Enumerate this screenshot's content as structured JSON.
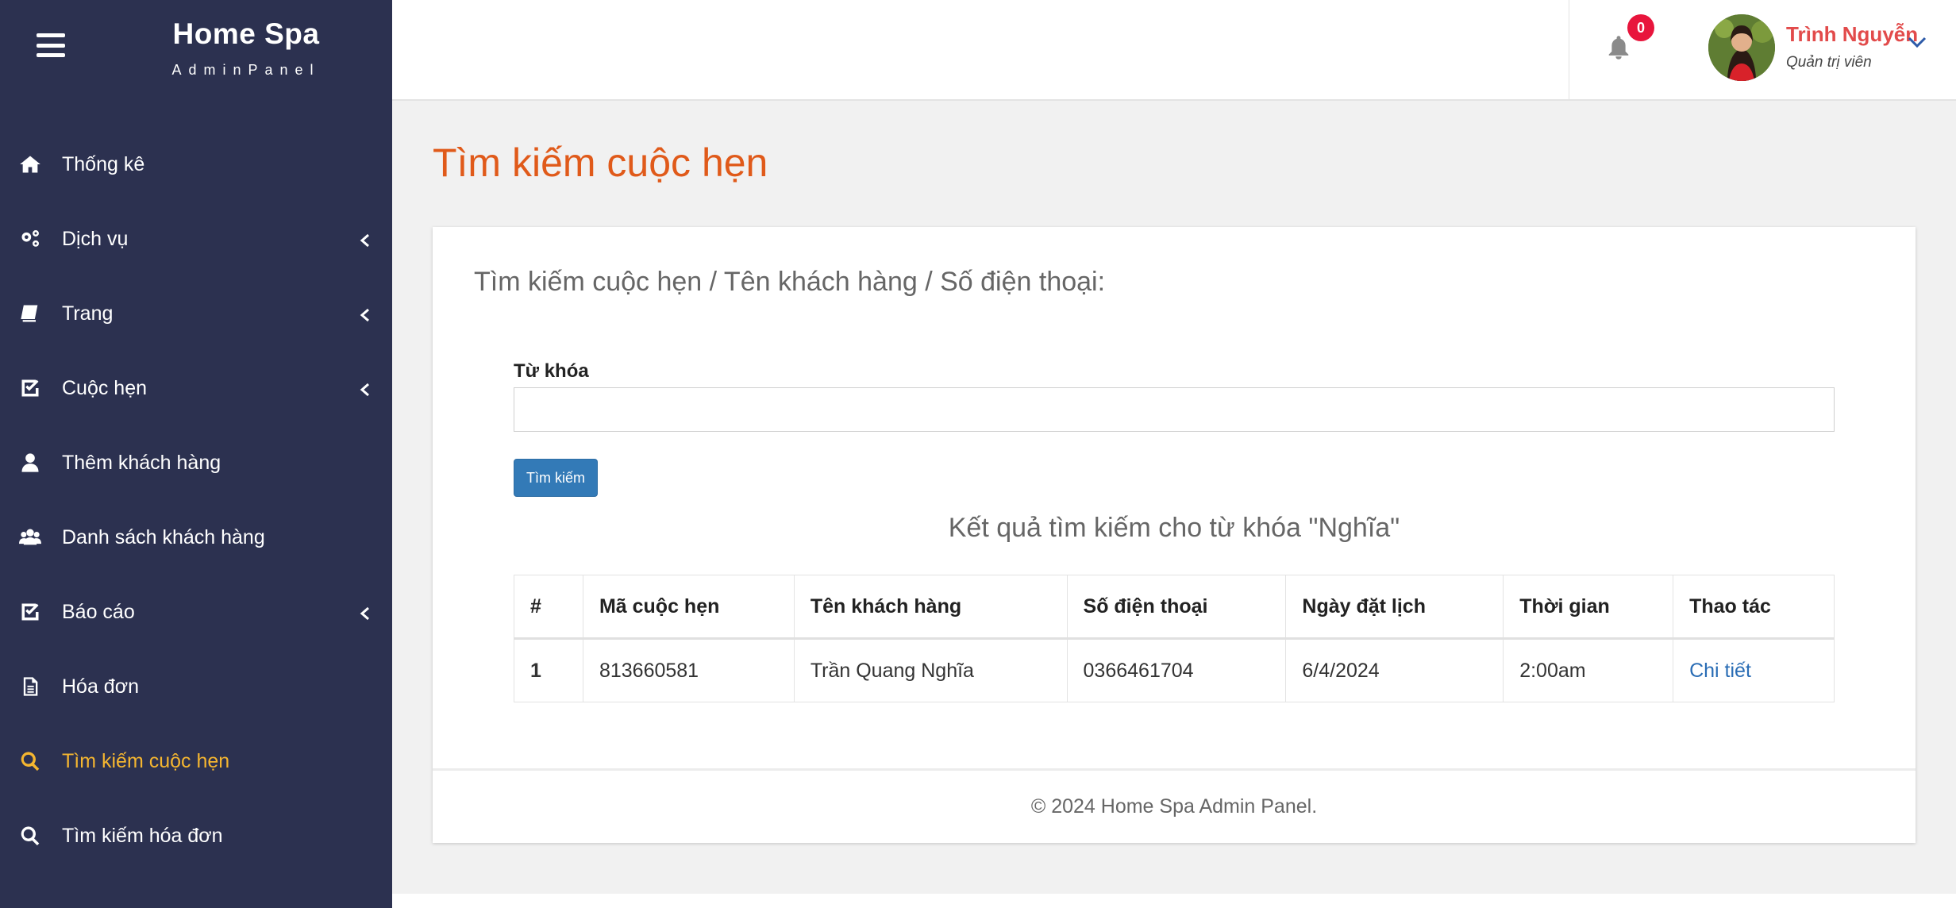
{
  "brand": {
    "title": "Home Spa",
    "subtitle": "AdminPanel"
  },
  "sidebar": {
    "items": [
      {
        "label": "Thống kê",
        "icon": "home-icon",
        "has_submenu": false,
        "active": false
      },
      {
        "label": "Dịch vụ",
        "icon": "gears-icon",
        "has_submenu": true,
        "active": false
      },
      {
        "label": "Trang",
        "icon": "book-icon",
        "has_submenu": true,
        "active": false
      },
      {
        "label": "Cuộc hẹn",
        "icon": "check-square-icon",
        "has_submenu": true,
        "active": false
      },
      {
        "label": "Thêm khách hàng",
        "icon": "user-icon",
        "has_submenu": false,
        "active": false
      },
      {
        "label": "Danh sách khách hàng",
        "icon": "users-icon",
        "has_submenu": false,
        "active": false
      },
      {
        "label": "Báo cáo",
        "icon": "check-square-icon",
        "has_submenu": true,
        "active": false
      },
      {
        "label": "Hóa đơn",
        "icon": "file-icon",
        "has_submenu": false,
        "active": false
      },
      {
        "label": "Tìm kiếm cuộc hẹn",
        "icon": "search-icon",
        "has_submenu": false,
        "active": true
      },
      {
        "label": "Tìm kiếm hóa đơn",
        "icon": "search-icon",
        "has_submenu": false,
        "active": false
      }
    ]
  },
  "topbar": {
    "notification_count": "0",
    "user_name": "Trình Nguyễn",
    "user_role": "Quản trị viên"
  },
  "page": {
    "title": "Tìm kiếm cuộc hẹn",
    "card_heading": "Tìm kiếm cuộc hẹn / Tên khách hàng / Số điện thoại:",
    "field_label": "Từ khóa",
    "field_value": "",
    "search_button": "Tìm kiếm",
    "result_title": "Kết quả tìm kiếm cho từ khóa \"Nghĩa\"",
    "footer": "© 2024 Home Spa Admin Panel."
  },
  "table": {
    "headers": [
      "#",
      "Mã cuộc hẹn",
      "Tên khách hàng",
      "Số điện thoại",
      "Ngày đặt lịch",
      "Thời gian",
      "Thao tác"
    ],
    "rows": [
      {
        "idx": "1",
        "code": "813660581",
        "name": "Trần Quang Nghĩa",
        "phone": "0366461704",
        "date": "6/4/2024",
        "time": "2:00am",
        "action": "Chi tiết"
      }
    ]
  },
  "colors": {
    "sidebar_bg": "#2c3150",
    "active_item": "#f5b630",
    "page_title": "#e05a1a",
    "user_name": "#e24b4b",
    "primary_button": "#337ab7",
    "badge": "#e8153c"
  }
}
